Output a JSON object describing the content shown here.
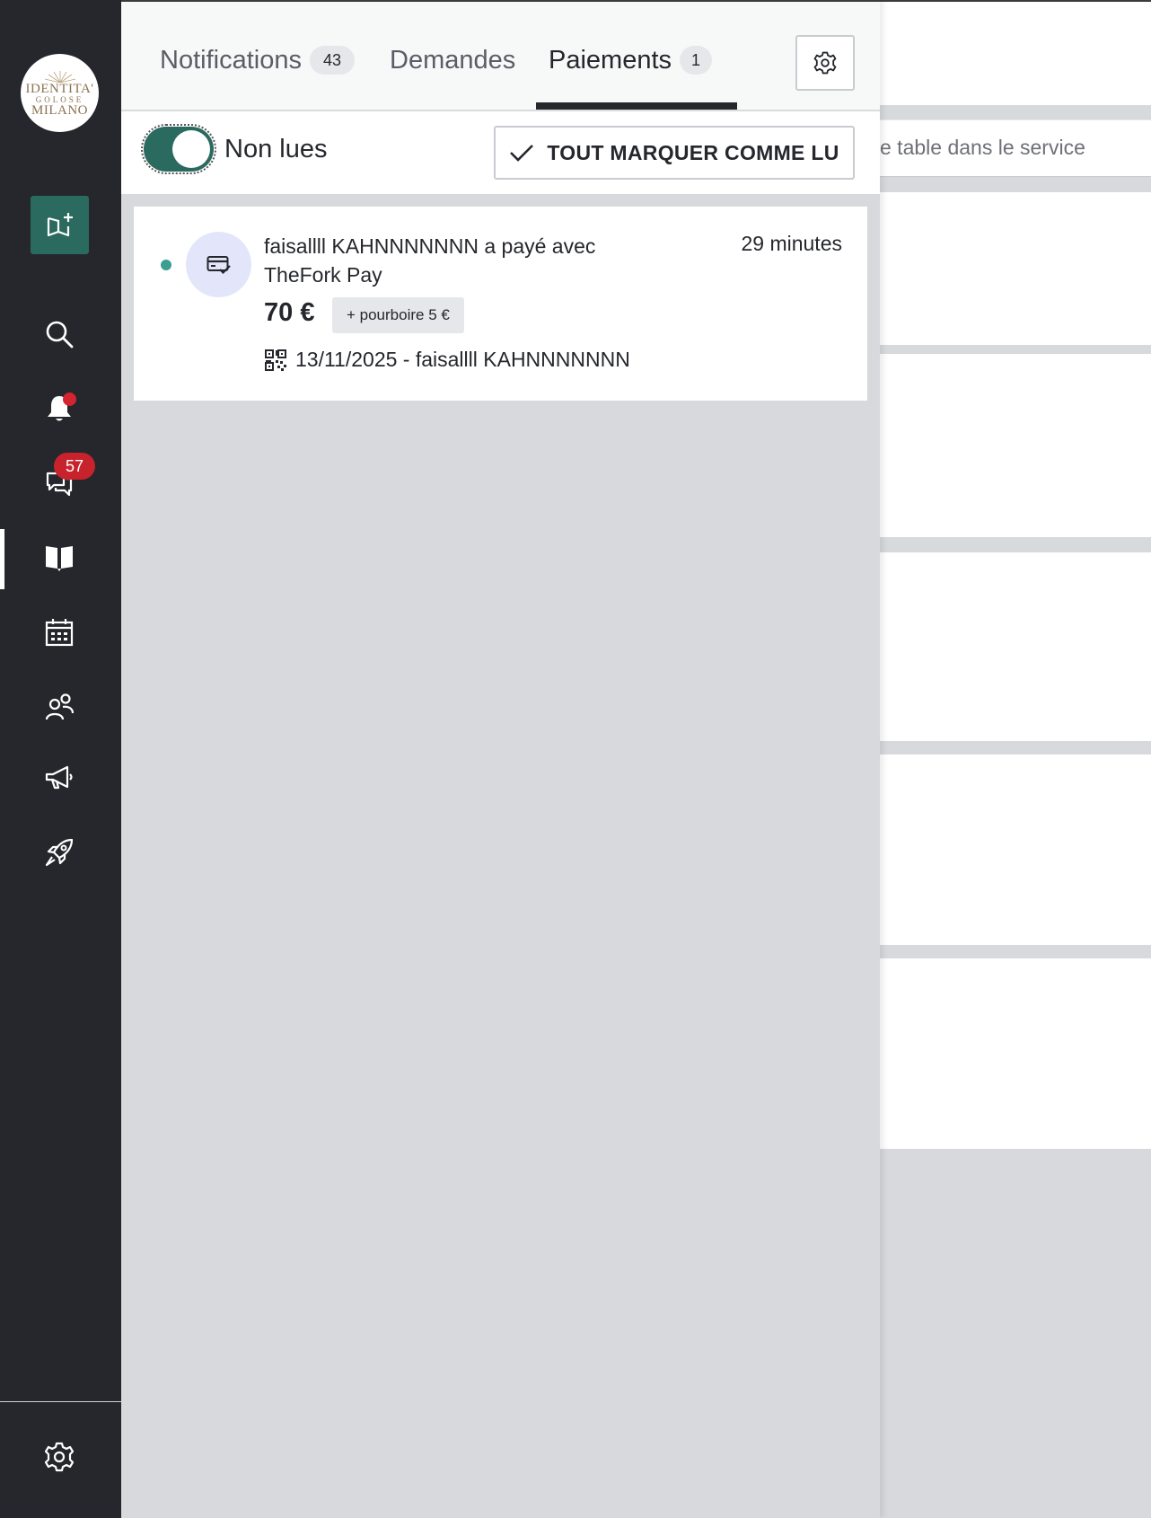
{
  "sidebar": {
    "logo": {
      "line1": "IDENTITA'",
      "line2": "GOLOSE",
      "line3": "MILANO"
    },
    "messages_badge": "57",
    "icons": [
      "add-booking-icon",
      "search-icon",
      "bell-icon",
      "chat-icon",
      "book-icon",
      "calendar-icon",
      "people-icon",
      "megaphone-icon",
      "rocket-icon",
      "settings-icon"
    ]
  },
  "drawer": {
    "tabs": [
      {
        "label": "Notifications",
        "count": "43"
      },
      {
        "label": "Demandes",
        "count": ""
      },
      {
        "label": "Paiements",
        "count": "1"
      }
    ],
    "active_tab": "Paiements",
    "filter": {
      "toggle_label": "Non lues",
      "toggle_on": true,
      "mark_all_label": "TOUT MARQUER COMME LU"
    },
    "notifications": [
      {
        "title": "faisallll KAHNNNNNNN a payé avec TheFork Pay",
        "time": "29 minutes",
        "amount": "70 €",
        "tip": "+ pourboire 5 €",
        "meta": "13/11/2025 - faisallll KAHNNNNNNN",
        "unread": true
      }
    ]
  },
  "background": {
    "search_placeholder": "e table dans le service"
  },
  "colors": {
    "sidebar": "#25272c",
    "accent_green": "#2b6a5f",
    "unread_dot": "#3b9e92",
    "badge_red": "#c8232c",
    "avatar_bg": "#e3e6fa"
  }
}
